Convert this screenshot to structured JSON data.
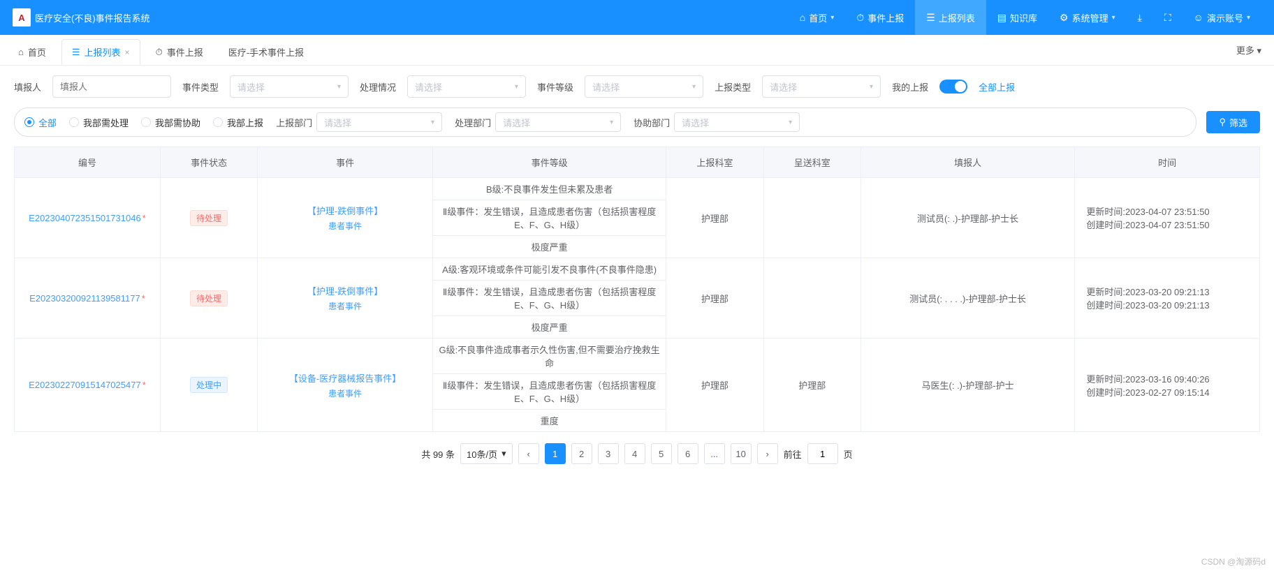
{
  "app": {
    "title": "医疗安全(不良)事件报告系统"
  },
  "nav": {
    "home": "首页",
    "report": "事件上报",
    "list": "上报列表",
    "kb": "知识库",
    "sys": "系统管理",
    "demo": "演示账号"
  },
  "tabs": {
    "home": "首页",
    "list": "上报列表",
    "report": "事件上报",
    "surgery": "医疗-手术事件上报",
    "more": "更多"
  },
  "filters": {
    "reporter_lbl": "填报人",
    "reporter_ph": "填报人",
    "type_lbl": "事件类型",
    "type_ph": "请选择",
    "status_lbl": "处理情况",
    "status_ph": "请选择",
    "level_lbl": "事件等级",
    "level_ph": "请选择",
    "rtype_lbl": "上报类型",
    "rtype_ph": "请选择",
    "mine_lbl": "我的上报",
    "all_link": "全部上报"
  },
  "radios": {
    "all": "全部",
    "need": "我部需处理",
    "assist": "我部需协助",
    "mine": "我部上报"
  },
  "dept": {
    "report_lbl": "上报部门",
    "report_ph": "请选择",
    "handle_lbl": "处理部门",
    "handle_ph": "请选择",
    "assist_lbl": "协助部门",
    "assist_ph": "请选择"
  },
  "btn": {
    "filter": "筛选"
  },
  "cols": {
    "code": "编号",
    "status": "事件状态",
    "event": "事件",
    "level": "事件等级",
    "rdept": "上报科室",
    "sdept": "呈送科室",
    "reporter": "填报人",
    "time": "时间"
  },
  "rows": [
    {
      "code": "E202304072351501731046",
      "status": "待处理",
      "status_cls": "tag-pending",
      "event": "【护理-跌倒事件】",
      "event_sub": "患者事件",
      "levels": [
        "B级:不良事件发生但未累及患者",
        "Ⅱ级事件：发生错误，且造成患者伤害（包括损害程度E、F、G、H级）",
        "极度严重"
      ],
      "rdept": "护理部",
      "sdept": "",
      "reporter": "测试员(:           .)-护理部-护士长",
      "update": "更新时间:2023-04-07 23:51:50",
      "create": "创建时间:2023-04-07 23:51:50"
    },
    {
      "code": "E202303200921139581177",
      "status": "待处理",
      "status_cls": "tag-pending",
      "event": "【护理-跌倒事件】",
      "event_sub": "患者事件",
      "levels": [
        "A级:客观环境或条件可能引发不良事件(不良事件隐患)",
        "Ⅱ级事件：发生错误，且造成患者伤害（包括损害程度E、F、G、H级）",
        "极度严重"
      ],
      "rdept": "护理部",
      "sdept": "",
      "reporter": "测试员(:   .  . . .)-护理部-护士长",
      "update": "更新时间:2023-03-20 09:21:13",
      "create": "创建时间:2023-03-20 09:21:13"
    },
    {
      "code": "E202302270915147025477",
      "status": "处理中",
      "status_cls": "tag-proc",
      "event": "【设备-医疗器械报告事件】",
      "event_sub": "患者事件",
      "levels": [
        "G级:不良事件造成事者示久性伤害,但不需要治疗挽救生命",
        "Ⅱ级事件：发生错误，且造成患者伤害（包括损害程度E、F、G、H级）",
        "重度"
      ],
      "rdept": "护理部",
      "sdept": "护理部",
      "reporter": "马医生(:           .)-护理部-护士",
      "update": "更新时间:2023-03-16 09:40:26",
      "create": "创建时间:2023-02-27 09:15:14"
    }
  ],
  "pagination": {
    "total": "共 99 条",
    "per": "10条/页",
    "pages": [
      "1",
      "2",
      "3",
      "4",
      "5",
      "6",
      "...",
      "10"
    ],
    "goto": "前往",
    "goto_val": "1",
    "page_suffix": "页"
  },
  "watermark": "CSDN @淘源码d"
}
